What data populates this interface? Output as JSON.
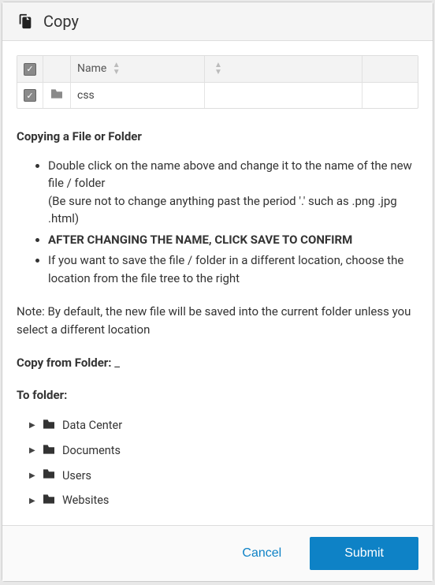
{
  "header": {
    "title": "Copy"
  },
  "table": {
    "headers": {
      "name": "Name"
    },
    "rows": [
      {
        "name": "css"
      }
    ]
  },
  "instructions": {
    "title": "Copying a File or Folder",
    "items": [
      "Double click on the name above and change it to the name of the new file / folder",
      "(Be sure not to change anything past the period '.' such as .png .jpg .html)",
      "AFTER CHANGING THE NAME, CLICK SAVE TO CONFIRM",
      "If you want to save the file / folder in a different location, choose the location from the file tree to the right"
    ],
    "note": "Note: By default, the new file will be saved into the current folder unless you select a different location"
  },
  "copy_from": {
    "label": "Copy from Folder:",
    "value": "_"
  },
  "to_folder_label": "To folder:",
  "tree": [
    {
      "label": "Data Center"
    },
    {
      "label": "Documents"
    },
    {
      "label": "Users"
    },
    {
      "label": "Websites"
    }
  ],
  "footer": {
    "cancel": "Cancel",
    "submit": "Submit"
  }
}
